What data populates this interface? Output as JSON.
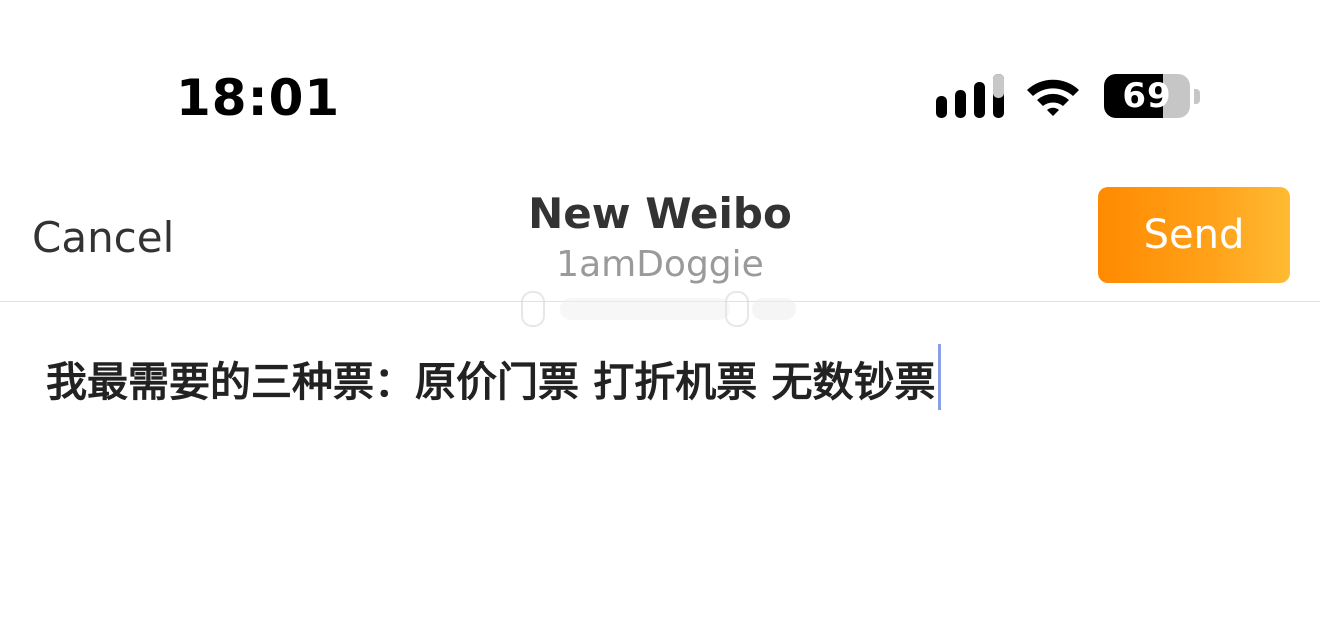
{
  "status_bar": {
    "time": "18:01",
    "battery_level": "69",
    "battery_fraction": 0.69,
    "signal_icon": "cellular-signal-icon",
    "wifi_icon": "wifi-icon"
  },
  "nav": {
    "cancel_label": "Cancel",
    "title": "New Weibo",
    "username": "1amDoggie",
    "send_label": "Send"
  },
  "compose": {
    "text": "我最需要的三种票：原价门票 打折机票 无数钞票"
  },
  "colors": {
    "send_gradient_start": "#ff8a00",
    "send_gradient_end": "#ffbb33",
    "cursor": "#8aa0e6",
    "subtitle": "#9a9a9a"
  }
}
